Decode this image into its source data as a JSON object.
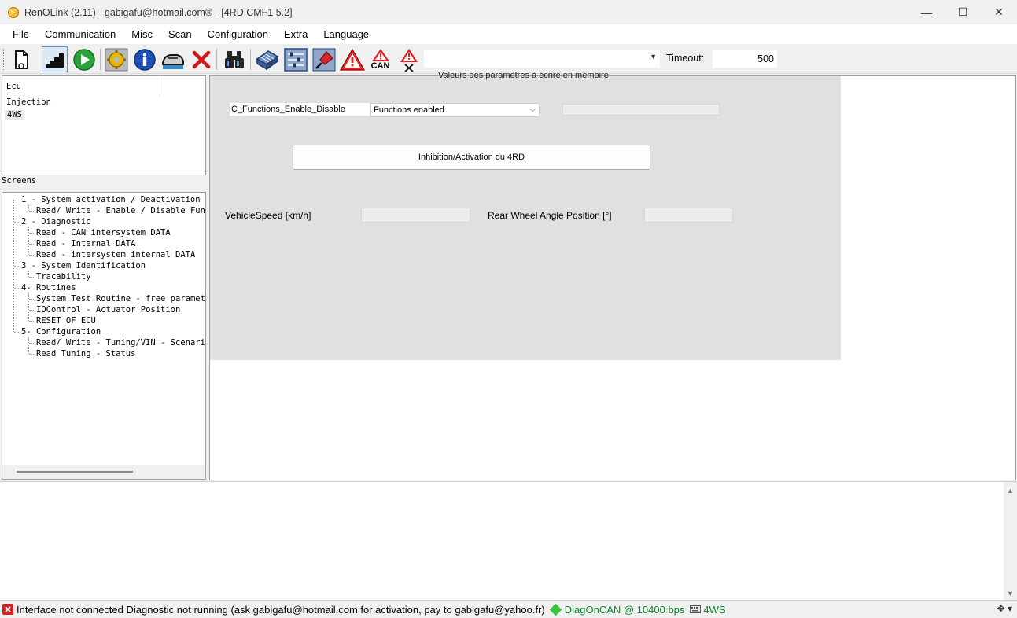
{
  "window": {
    "title": "RenOLink (2.11) - gabigafu@hotmail.com® -  [4RD CMF1 5.2]",
    "controls": {
      "minimize": "—",
      "maximize": "☐",
      "close": "✕"
    }
  },
  "menu": [
    "File",
    "Communication",
    "Misc",
    "Scan",
    "Configuration",
    "Extra",
    "Language"
  ],
  "toolbar": {
    "can_label": "CAN",
    "timeout_label": "Timeout:",
    "timeout_value": "500",
    "dropdown_value": "",
    "icons": [
      "new-file-icon",
      "stairs-icon",
      "play-icon",
      "gear-icon",
      "info-icon",
      "car-icon",
      "stop-icon",
      "binoculars-icon",
      "ecu-icon",
      "settings-panel-icon",
      "pin-icon",
      "warning-icon",
      "can-warning-icon",
      "warning-clear-icon"
    ]
  },
  "ecu_panel": {
    "header": "Ecu",
    "rows": [
      "Injection",
      "4WS"
    ],
    "selected": "4WS"
  },
  "screens_label": "Screens",
  "tree": [
    {
      "label": "1 - System activation / Deactivation",
      "level": 0
    },
    {
      "label": "Read/ Write - Enable / Disable Funct",
      "level": 1
    },
    {
      "label": "2 - Diagnostic",
      "level": 0
    },
    {
      "label": "Read - CAN intersystem DATA",
      "level": 1
    },
    {
      "label": "Read - Internal DATA",
      "level": 1
    },
    {
      "label": "Read - intersystem internal DATA",
      "level": 1
    },
    {
      "label": "3 - System Identification",
      "level": 0
    },
    {
      "label": "Tracability",
      "level": 1
    },
    {
      "label": "4- Routines",
      "level": 0
    },
    {
      "label": "System Test Routine - free parameter",
      "level": 1
    },
    {
      "label": "IOControl - Actuator Position",
      "level": 1
    },
    {
      "label": "RESET OF ECU",
      "level": 1
    },
    {
      "label": "5- Configuration",
      "level": 0
    },
    {
      "label": "Read/ Write - Tuning/VIN - Scenario",
      "level": 1
    },
    {
      "label": "Read Tuning - Status",
      "level": 1
    }
  ],
  "main": {
    "heading": "Valeurs des paramètres à écrire en mémoire",
    "param_name": "C_Functions_Enable_Disable",
    "param_select": "Functions enabled",
    "param_value": "",
    "button_label": "Inhibition/Activation du 4RD",
    "vehicle_speed_label": "VehicleSpeed [km/h]",
    "vehicle_speed_value": "",
    "rear_wheel_label": "Rear Wheel Angle Position [°]",
    "rear_wheel_value": ""
  },
  "status": {
    "message": "Interface not connected Diagnostic not running (ask gabigafu@hotmail.com for activation, pay to gabigafu@yahoo.fr)",
    "protocol": "DiagOnCAN @ 10400 bps",
    "ecu": "4WS"
  },
  "colors": {
    "status_green": "#0a8a2a",
    "panel_gray": "#e0e0e0",
    "error_red": "#d32020"
  }
}
